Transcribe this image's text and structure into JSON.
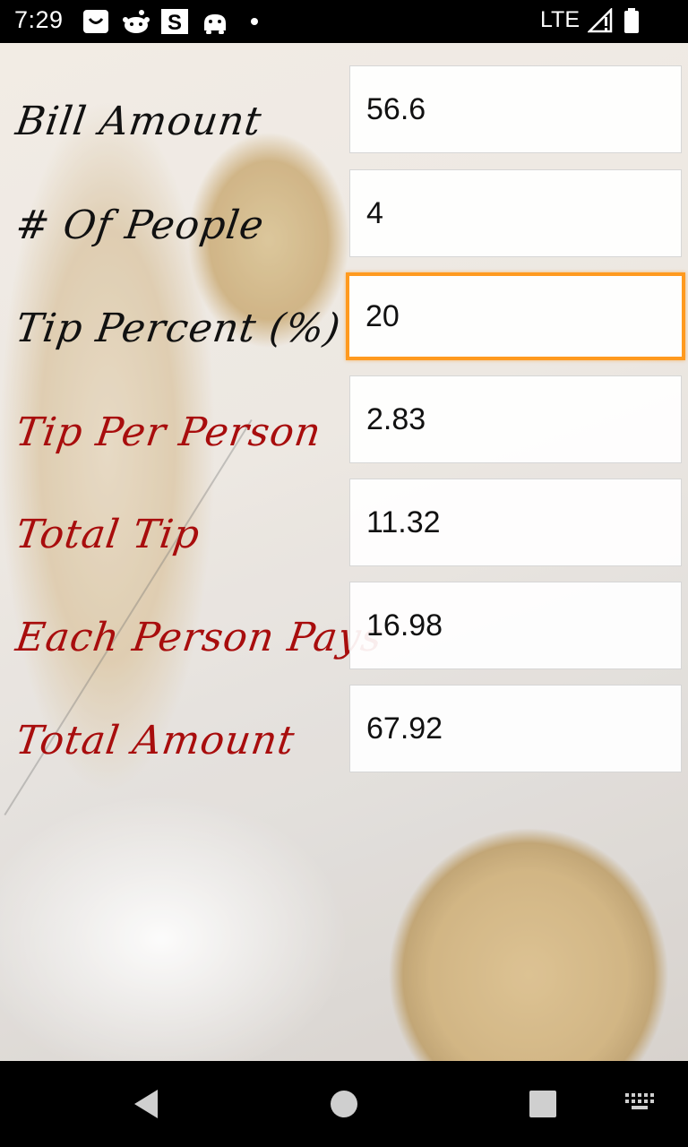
{
  "status_bar": {
    "time": "7:29",
    "network": "LTE",
    "icons": [
      "notification-app-icon",
      "reddit-icon",
      "s-app-icon",
      "android-icon",
      "dot-icon",
      "signal-icon",
      "battery-icon"
    ]
  },
  "form": {
    "rows": [
      {
        "label": "Bill Amount",
        "value": "56.6",
        "color": "#111111"
      },
      {
        "label": "# Of People",
        "value": "4",
        "color": "#111111"
      },
      {
        "label": "Tip Percent (%)",
        "value": "20",
        "color": "#111111",
        "focused": true
      },
      {
        "label": "Tip Per Person",
        "value": "2.83",
        "color": "#a80d0d"
      },
      {
        "label": "Total Tip",
        "value": "11.32",
        "color": "#a80d0d"
      },
      {
        "label": "Each Person Pays",
        "value": "16.98",
        "color": "#a80d0d"
      },
      {
        "label": "Total Amount",
        "value": "67.92",
        "color": "#a80d0d"
      }
    ],
    "focus_color": "#ff9a1f"
  },
  "nav_bar": {
    "buttons": [
      "back-icon",
      "home-icon",
      "recents-icon",
      "keyboard-icon"
    ]
  }
}
